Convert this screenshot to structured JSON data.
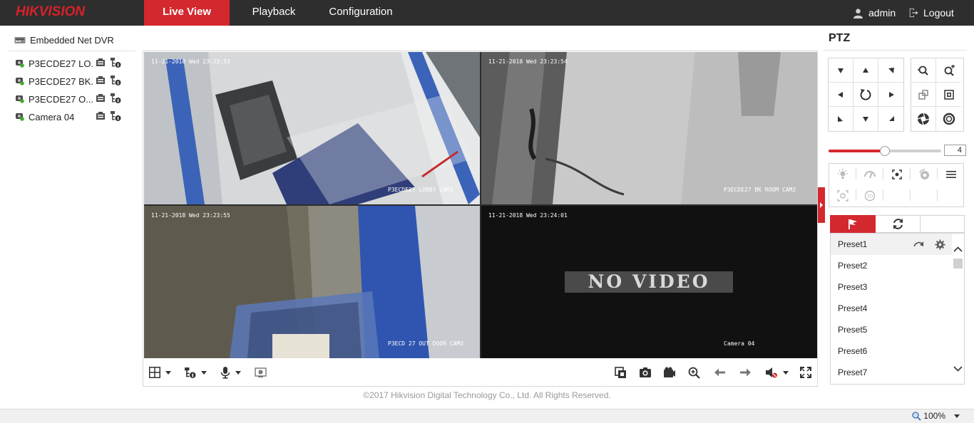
{
  "header": {
    "logo": "HIKVISION",
    "tabs": [
      {
        "label": "Live View",
        "active": true
      },
      {
        "label": "Playback",
        "active": false
      },
      {
        "label": "Configuration",
        "active": false
      }
    ],
    "user": "admin",
    "logout": "Logout"
  },
  "device_tree": {
    "root": "Embedded Net DVR",
    "cameras": [
      {
        "label": "P3ECDE27 LO..."
      },
      {
        "label": "P3ECDE27 BK..."
      },
      {
        "label": "P3ECDE27 O..."
      },
      {
        "label": "Camera 04"
      }
    ]
  },
  "video": {
    "panes": [
      {
        "timestamp": "11-21-2018 Wed 23:23:53",
        "name": "P3ECDE27 LOBBY CAM1"
      },
      {
        "timestamp": "11-21-2018 Wed 23:23:54",
        "name": "P3ECDE27 BK ROOM CAM2"
      },
      {
        "timestamp": "11-21-2018 Wed 23:23:55",
        "name": "P3ECD 27 OUT DOOR CAM3"
      },
      {
        "timestamp": "11-21-2018 Wed 23:24:01",
        "name": "Camera 04",
        "overlay": "NO VIDEO"
      }
    ]
  },
  "footer": "©2017 Hikvision Digital Technology Co., Ltd. All Rights Reserved.",
  "ptz": {
    "title": "PTZ",
    "speed": "4",
    "speed_fraction": 0.5,
    "presets": [
      "Preset1",
      "Preset2",
      "Preset3",
      "Preset4",
      "Preset5",
      "Preset6",
      "Preset7"
    ]
  },
  "statusbar": {
    "zoom": "100%"
  },
  "colors": {
    "accent": "#d3282e",
    "topbar": "#2e2e2e",
    "selection": "#e8b923"
  }
}
